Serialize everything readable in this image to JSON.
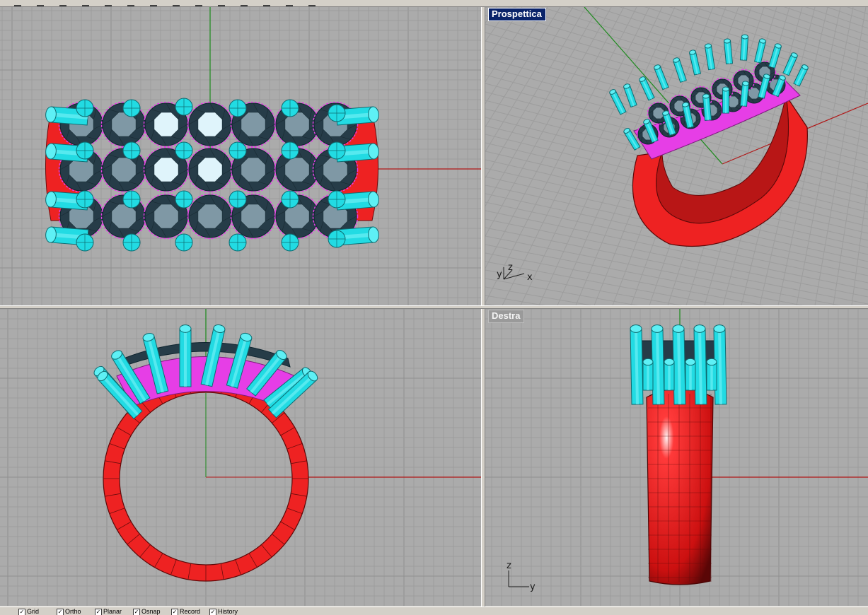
{
  "viewports": {
    "top": {
      "label": ""
    },
    "perspective": {
      "label": "Prospettica",
      "active": true
    },
    "front": {
      "label": ""
    },
    "right": {
      "label": "Destra",
      "active": false
    }
  },
  "axes": {
    "perspective": {
      "x": "x",
      "y": "y",
      "z": "z"
    },
    "right": {
      "y": "y",
      "z": "z"
    }
  },
  "toolbar": {
    "icons": [
      "select-icon",
      "point-icon",
      "curve-icon",
      "polyline-icon",
      "circle-icon",
      "arc-icon",
      "rectangle-icon",
      "surface-icon",
      "solid-icon",
      "mesh-icon",
      "render-icon",
      "sphere-icon",
      "torus-icon",
      "analyze-icon"
    ]
  },
  "statusbar": {
    "osnap": [
      "Grid",
      "Ortho",
      "Planar",
      "Osnap",
      "Record History"
    ],
    "items": [
      {
        "label": "Grid",
        "checked": true
      },
      {
        "label": "Ortho",
        "checked": true
      },
      {
        "label": "Planar",
        "checked": true
      },
      {
        "label": "Osnap",
        "checked": true
      },
      {
        "label": "Record",
        "checked": true
      },
      {
        "label": "History",
        "checked": true
      }
    ]
  },
  "colors": {
    "viewport_bg": "#ababab",
    "grid_line": "#9d9d9d",
    "grid_major": "#8f8f8f",
    "x_axis": "#b01818",
    "y_axis": "#1c8a1c",
    "ring_band": "#ee2222",
    "prong": "#22dbe3",
    "setting": "#e63ee6",
    "gem_dark": "#263c48",
    "gem_light": "#dff4fb",
    "active_label": "#0a246a",
    "inactive_label": "#9a9a9a"
  }
}
